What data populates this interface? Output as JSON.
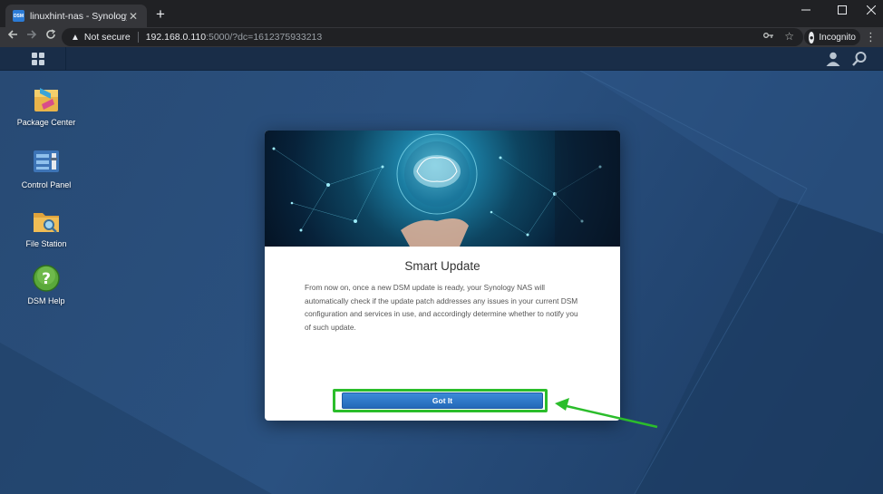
{
  "browser": {
    "tab_favicon": "DSM",
    "tab_title": "linuxhint-nas - Synology NAS",
    "tab_close": "✕",
    "new_tab": "+",
    "security_label": "Not secure",
    "url_host": "192.168.0.110",
    "url_rest": ":5000/?dc=1612375933213",
    "profile_label": "Incognito"
  },
  "desktop": {
    "icons": [
      {
        "label": "Package Center",
        "icon": "package-center-icon"
      },
      {
        "label": "Control Panel",
        "icon": "control-panel-icon"
      },
      {
        "label": "File Station",
        "icon": "file-station-icon"
      },
      {
        "label": "DSM Help",
        "icon": "dsm-help-icon"
      }
    ]
  },
  "dialog": {
    "title": "Smart Update",
    "body": "From now on, once a new DSM update is ready, your Synology NAS will automatically check if the update patch addresses any issues in your current DSM configuration and services in use, and accordingly determine whether to notify you of such update.",
    "button_label": "Got It"
  },
  "colors": {
    "highlight": "#2bbd2b",
    "button": "#2d75c6",
    "desktop": "#2a5180"
  }
}
